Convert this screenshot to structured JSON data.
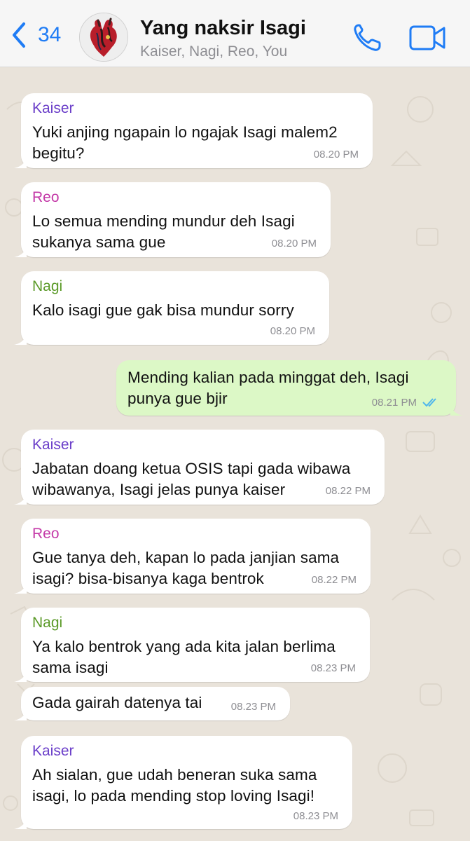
{
  "header": {
    "back_count": "34",
    "title": "Yang naksir Isagi",
    "subtitle": "Kaiser, Nagi, Reo, You"
  },
  "colors": {
    "kaiser": "#6b3fc9",
    "reo": "#c43aa8",
    "nagi": "#5b9a28",
    "ios_blue": "#1f7cf5",
    "outgoing_bubble": "#dcf8c6",
    "read_ticks": "#4fb6ec"
  },
  "messages": [
    {
      "sender": "Kaiser",
      "line1": "Yuki anjing ngapain lo ngajak Isagi malem2",
      "line2": "begitu?",
      "time": "08.20 PM"
    },
    {
      "sender": "Reo",
      "line1": "Lo semua mending mundur deh Isagi",
      "line2": "sukanya sama gue",
      "time": "08.20 PM"
    },
    {
      "sender": "Nagi",
      "line1": "Kalo isagi gue gak bisa mundur sorry",
      "line2": "",
      "time": "08.20 PM"
    },
    {
      "sender": "",
      "line1": "Mending kalian pada minggat deh, Isagi",
      "line2": "punya gue bjir",
      "time": "08.21 PM"
    },
    {
      "sender": "Kaiser",
      "line1": "Jabatan doang ketua OSIS tapi gada wibawa",
      "line2": "wibawanya, Isagi jelas punya kaiser",
      "time": "08.22 PM"
    },
    {
      "sender": "Reo",
      "line1": "Gue tanya deh, kapan lo pada janjian sama",
      "line2": "isagi? bisa-bisanya kaga bentrok",
      "time": "08.22 PM"
    },
    {
      "sender": "Nagi",
      "line1": "Ya kalo bentrok yang ada kita jalan berlima",
      "line2": "sama isagi",
      "time": "08.23 PM"
    },
    {
      "sender": "",
      "line1": "Gada gairah datenya tai",
      "line2": "",
      "time": "08.23 PM"
    },
    {
      "sender": "Kaiser",
      "line1": "Ah sialan, gue udah beneran suka sama",
      "line2": "isagi, lo pada mending stop loving Isagi!",
      "time": "08.23 PM"
    }
  ]
}
